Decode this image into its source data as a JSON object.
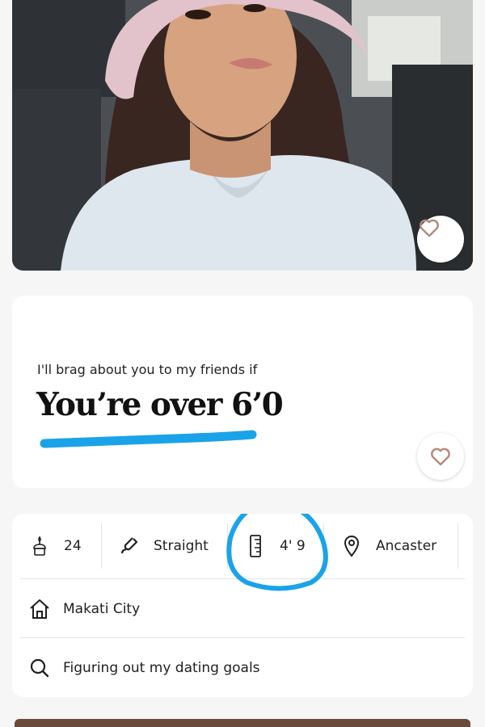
{
  "profile": {
    "photo_alt": "Profile photo",
    "prompt": {
      "question": "I'll brag about you to my friends if",
      "answer": "You’re over 6’0"
    },
    "details": {
      "age": "24",
      "orientation": "Straight",
      "height": "4' 9",
      "location": "Ancaster",
      "hometown": "Makati City",
      "dating_goal": "Figuring out my dating goals"
    }
  },
  "colors": {
    "annotation": "#1aa3e8",
    "heart": "#b58b7e"
  },
  "icons": {
    "like": "heart-icon",
    "age": "birthday-cake-icon",
    "orientation": "magnet-icon",
    "height": "ruler-icon",
    "location": "map-pin-icon",
    "hometown": "house-icon",
    "dating_goal": "search-icon"
  }
}
